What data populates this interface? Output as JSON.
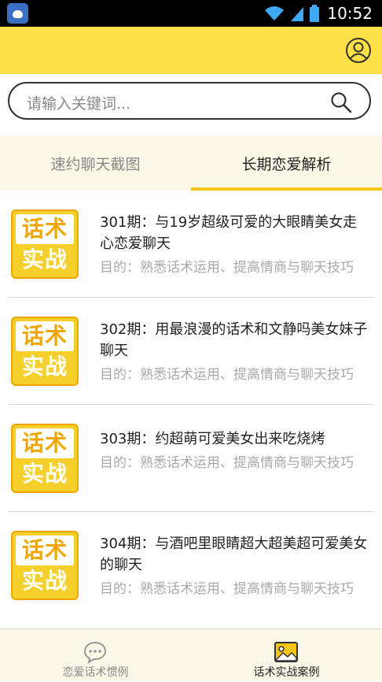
{
  "status_bar": {
    "time": "10:52"
  },
  "search": {
    "placeholder": "请输入关键词..."
  },
  "tabs": [
    {
      "label": "速约聊天截图",
      "active": false
    },
    {
      "label": "长期恋爱解析",
      "active": true
    }
  ],
  "thumb": {
    "top": "话术",
    "bottom": "实战"
  },
  "items": [
    {
      "title": "301期：与19岁超级可爱的大眼睛美女走心恋爱聊天",
      "desc": "目的：熟悉话术运用、提高情商与聊天技巧"
    },
    {
      "title": "302期：用最浪漫的话术和文静吗美女妹子聊天",
      "desc": "目的：熟悉话术运用、提高情商与聊天技巧"
    },
    {
      "title": "303期：约超萌可爱美女出来吃烧烤",
      "desc": "目的：熟悉话术运用、提高情商与聊天技巧"
    },
    {
      "title": "304期：与酒吧里眼睛超大超美超可爱美女的聊天",
      "desc": "目的：熟悉话术运用、提高情商与聊天技巧"
    }
  ],
  "bottom_nav": [
    {
      "label": "恋爱话术惯例",
      "icon": "chat-bubble-icon",
      "active": false
    },
    {
      "label": "话术实战案例",
      "icon": "image-icon",
      "active": true
    }
  ],
  "colors": {
    "header": "#fde047",
    "accent": "#f5c518",
    "tab_bg": "#fbf7e7"
  }
}
